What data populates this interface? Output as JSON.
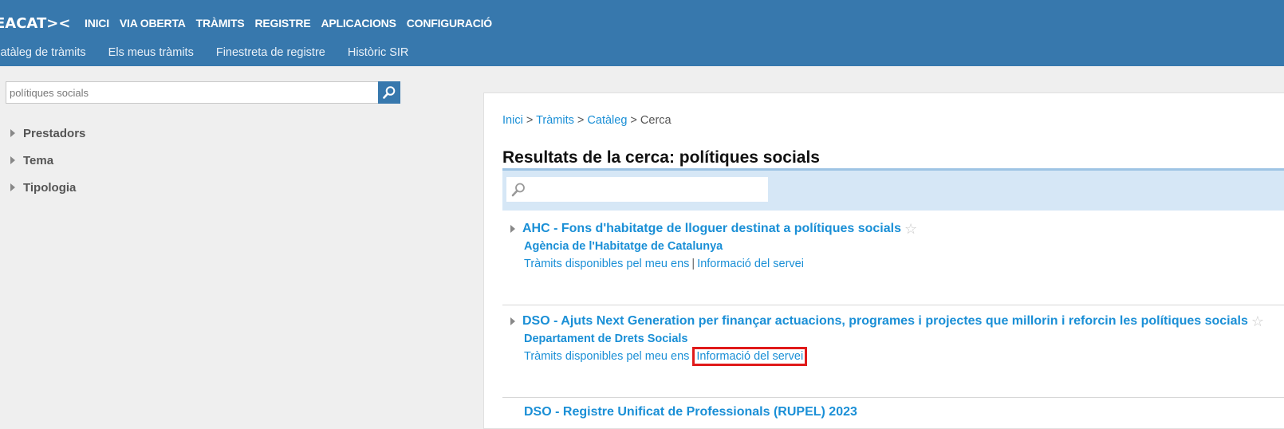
{
  "brand": {
    "logo_text": "EACAT><"
  },
  "main_nav": [
    "INICI",
    "VIA OBERTA",
    "TRÀMITS",
    "REGISTRE",
    "APLICACIONS",
    "CONFIGURACIÓ"
  ],
  "sub_nav": [
    "Catàleg de tràmits",
    "Els meus tràmits",
    "Finestreta de registre",
    "Històric SIR"
  ],
  "search": {
    "value": "polítiques socials"
  },
  "facets": [
    "Prestadors",
    "Tema",
    "Tipologia"
  ],
  "breadcrumb": {
    "items": [
      "Inici",
      "Tràmits",
      "Catàleg"
    ],
    "current": "Cerca",
    "separator": ">"
  },
  "results_title": "Resultats de la cerca: polítiques socials",
  "results": [
    {
      "title": "AHC - Fons d'habitatge de lloguer destinat a polítiques socials",
      "organization": "Agència de l'Habitatge de Catalunya",
      "link_tramits": "Tràmits disponibles pel meu ens",
      "link_info": "Informació del servei"
    },
    {
      "title": "DSO - Ajuts Next Generation per finançar actuacions, programes i projectes que millorin i reforcin les polítiques socials",
      "organization": "Departament de Drets Socials",
      "link_tramits": "Tràmits disponibles pel meu ens",
      "link_info": "Informació del servei"
    }
  ],
  "link_separator": "|",
  "partial_result_title": "DSO - Registre Unificat de Professionals (RUPEL) 2023",
  "colors": {
    "header": "#3778ad",
    "link": "#1a8fd6",
    "highlight": "#e01a1a",
    "filter_bar": "#d6e7f6"
  },
  "icons": [
    "search-icon",
    "magnifier-icon",
    "triangle-right-icon",
    "star-icon"
  ]
}
